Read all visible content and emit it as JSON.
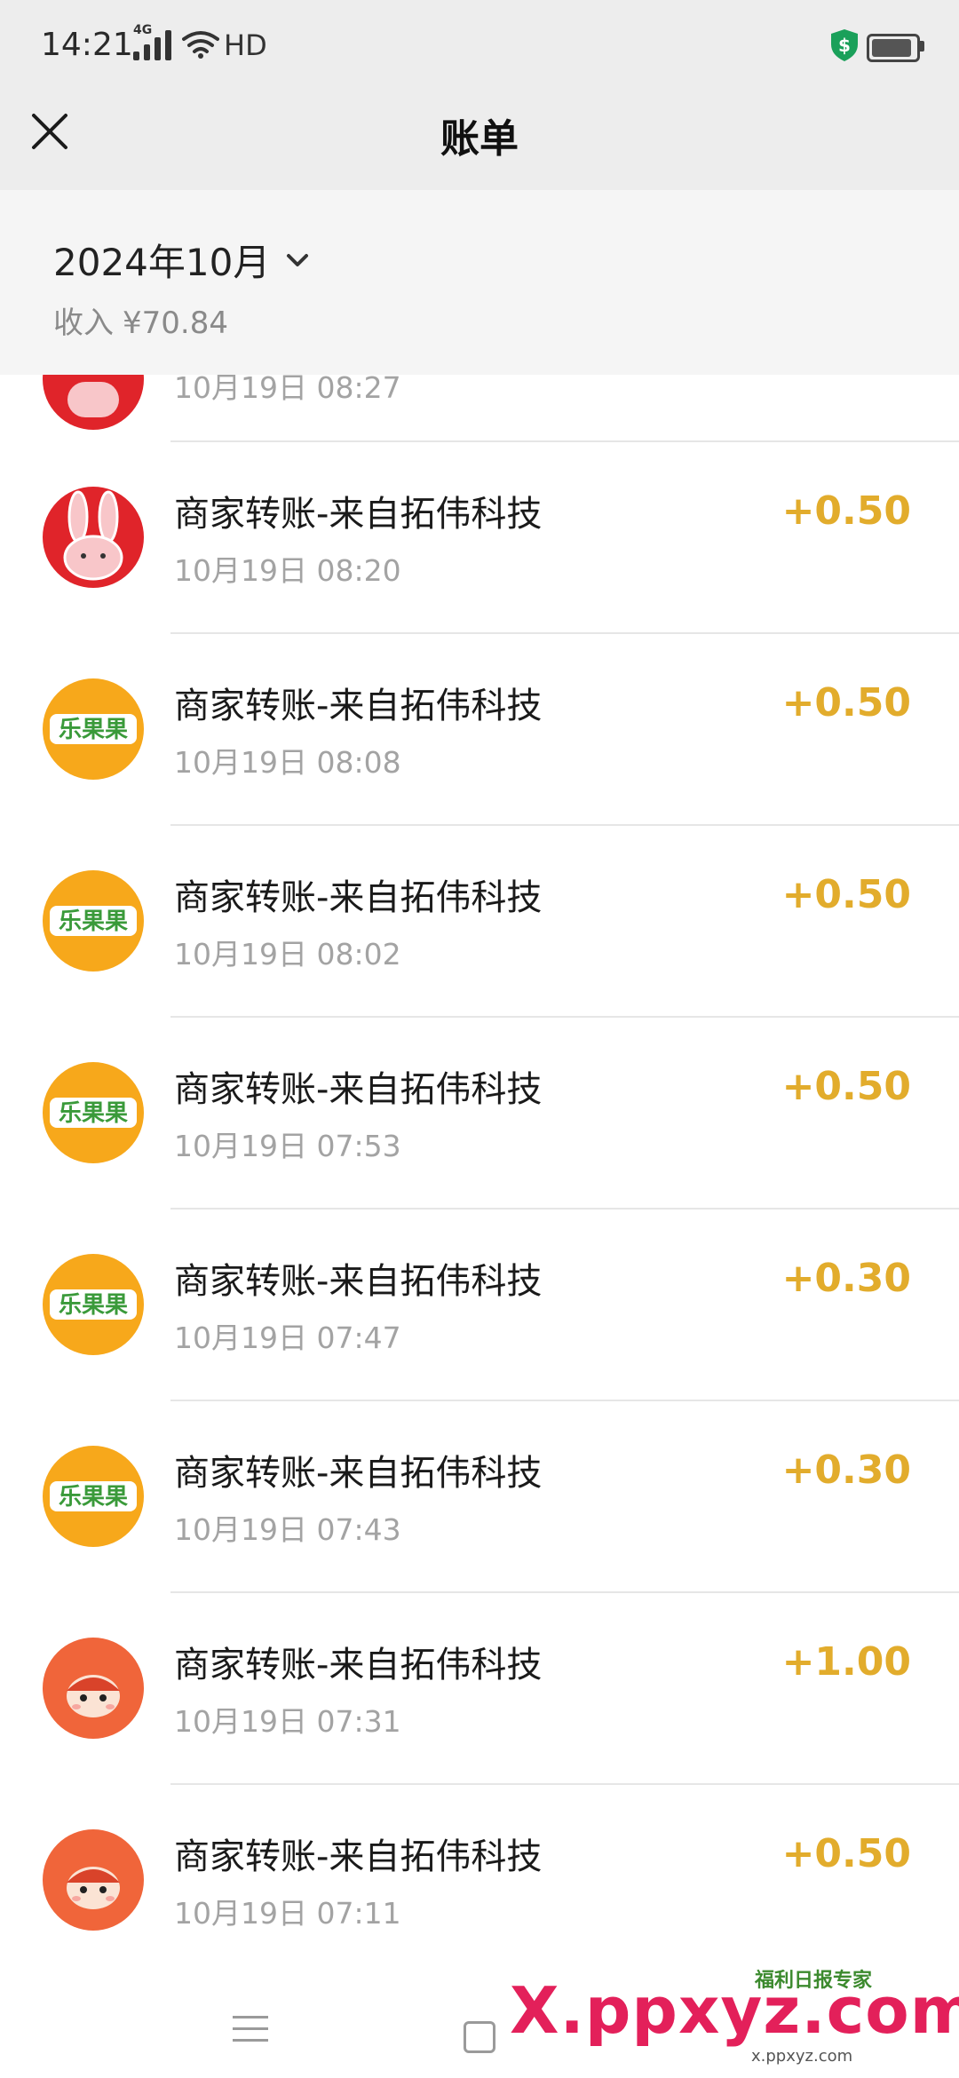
{
  "status_bar": {
    "time": "14:21",
    "network": "4G",
    "hd": "HD"
  },
  "nav": {
    "title": "账单"
  },
  "header": {
    "month": "2024年10月",
    "income_label": "收入",
    "income_value": "¥70.84"
  },
  "partial_row": {
    "time": "10月19日 08:27"
  },
  "transactions": [
    {
      "title": "商家转账-来自拓伟科技",
      "time": "10月19日 08:20",
      "amount": "+0.50",
      "avatar": "rabbit-icon"
    },
    {
      "title": "商家转账-来自拓伟科技",
      "time": "10月19日 08:08",
      "amount": "+0.50",
      "avatar": "leguoguo-logo",
      "logo_text": "乐果果"
    },
    {
      "title": "商家转账-来自拓伟科技",
      "time": "10月19日 08:02",
      "amount": "+0.50",
      "avatar": "leguoguo-logo",
      "logo_text": "乐果果"
    },
    {
      "title": "商家转账-来自拓伟科技",
      "time": "10月19日 07:53",
      "amount": "+0.50",
      "avatar": "leguoguo-logo",
      "logo_text": "乐果果"
    },
    {
      "title": "商家转账-来自拓伟科技",
      "time": "10月19日 07:47",
      "amount": "+0.30",
      "avatar": "leguoguo-logo",
      "logo_text": "乐果果"
    },
    {
      "title": "商家转账-来自拓伟科技",
      "time": "10月19日 07:43",
      "amount": "+0.30",
      "avatar": "leguoguo-logo",
      "logo_text": "乐果果"
    },
    {
      "title": "商家转账-来自拓伟科技",
      "time": "10月19日 07:31",
      "amount": "+1.00",
      "avatar": "mascot-face-icon"
    },
    {
      "title": "商家转账-来自拓伟科技",
      "time": "10月19日 07:11",
      "amount": "+0.50",
      "avatar": "mascot-face-icon"
    }
  ],
  "watermark": {
    "main": "X.ppxyz.com",
    "sub": "福利日报专家",
    "small": "x.ppxyz.com"
  },
  "colors": {
    "amount": "#e2ac2c",
    "header_bg": "#ededed",
    "rabbit_red": "#e0242a",
    "leguoguo_orange": "#f7a81b",
    "leguoguo_green": "#3a9a3a",
    "mascot_orange": "#f0653a"
  }
}
